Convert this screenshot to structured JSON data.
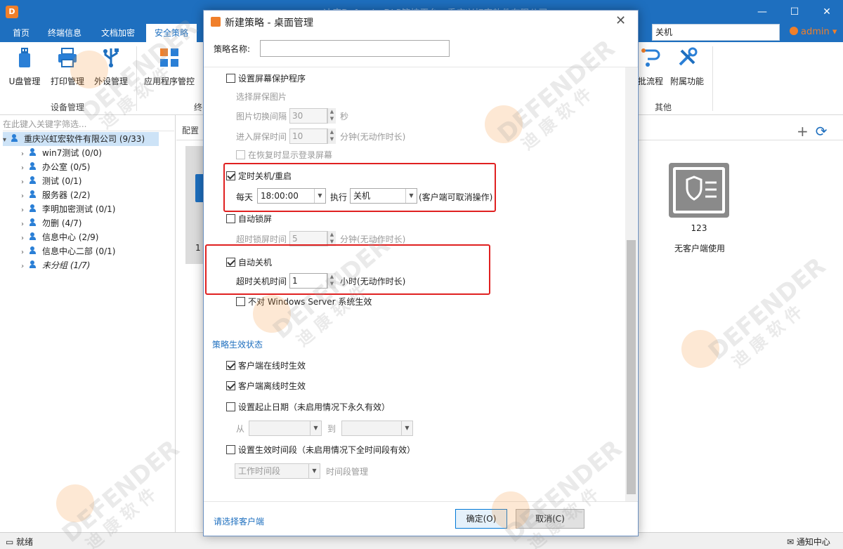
{
  "window": {
    "title": "迪康DefenderDLP管控平台 - 重庆兴虹宏软件有限公司",
    "minimize": "—",
    "maximize": "☐",
    "close": "✕"
  },
  "menu": {
    "tabs": [
      "首页",
      "终端信息",
      "文档加密",
      "安全策略"
    ],
    "search_value": "关机",
    "user": "admin",
    "user_caret": "▾"
  },
  "ribbon": {
    "items": [
      "U盘管理",
      "打印管理",
      "外设管理",
      "应用程序管控",
      "审批流程",
      "附属功能"
    ],
    "groups": [
      "设备管理",
      "终",
      "其他"
    ]
  },
  "left_panel": {
    "filter_placeholder": "在此键入关键字筛选...",
    "root": "重庆兴虹宏软件有限公司 (9/33)",
    "children": [
      "win7测试 (0/0)",
      "办公室 (0/5)",
      "测试 (0/1)",
      "服务器 (2/2)",
      "李明加密测试 (0/1)",
      "勿删 (4/7)",
      "信息中心 (2/9)",
      "信息中心二部 (0/1)",
      "未分组 (1/7)"
    ]
  },
  "right_panel": {
    "header": "配置",
    "add_icon": "+",
    "refresh_icon": "⟳",
    "card_name": "123",
    "card_status": "无客户端使用",
    "left_card_num": "1"
  },
  "status": {
    "left": "就绪",
    "right": "通知中心"
  },
  "dialog": {
    "title": "新建策略 - 桌面管理",
    "close": "✕",
    "name_label": "策略名称:",
    "screensaver": {
      "label": "设置屏幕保护程序",
      "pick_image": "选择屏保图片",
      "interval_label": "图片切换间隔",
      "interval_value": "30",
      "interval_unit": "秒",
      "enter_label": "进入屏保时间",
      "enter_value": "10",
      "enter_unit": "分钟(无动作时长)",
      "resume_label": "在恢复时显示登录屏幕"
    },
    "scheduled": {
      "label": "定时关机/重启",
      "daily": "每天",
      "time": "18:00:00",
      "exec": "执行",
      "action": "关机",
      "note": "(客户端可取消操作)"
    },
    "autolock": {
      "label": "自动锁屏",
      "timeout_label": "超时锁屏时间",
      "timeout_value": "5",
      "timeout_unit": "分钟(无动作时长)"
    },
    "autoshutdown": {
      "label": "自动关机",
      "timeout_label": "超时关机时间",
      "timeout_value": "1",
      "timeout_unit": "小时(无动作时长)",
      "server_label": "不对 Windows Server 系统生效"
    },
    "effect": {
      "title": "策略生效状态",
      "online": "客户端在线时生效",
      "offline": "客户端离线时生效",
      "date_label": "设置起止日期（未启用情况下永久有效）",
      "from": "从",
      "to": "到",
      "period_label": "设置生效时间段（未启用情况下全时间段有效）",
      "period_value": "工作时间段",
      "period_manage": "时间段管理"
    },
    "select_client": "请选择客户端",
    "ok": "确定(O)",
    "cancel": "取消(C)"
  },
  "watermark": {
    "brand": "DEFENDER",
    "cn": "迪 康 软 件"
  }
}
